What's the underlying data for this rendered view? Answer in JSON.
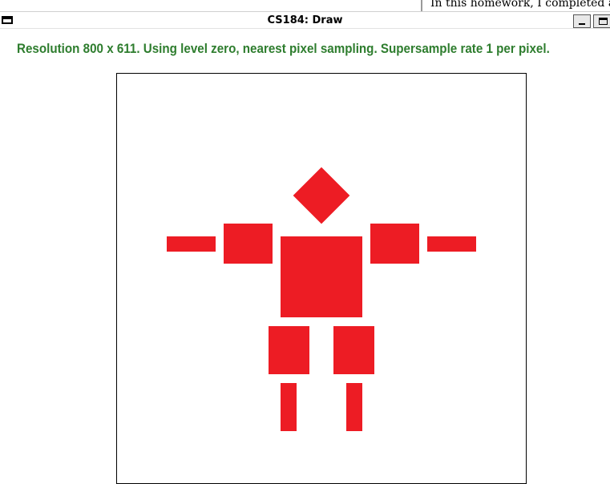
{
  "background_window": {
    "text": "In this homework, I completed an i"
  },
  "window": {
    "title": "CS184: Draw",
    "minimize_label": "_"
  },
  "status": {
    "text": "Resolution 800 x 611. Using level zero, nearest pixel sampling. Supersample rate 1 per pixel."
  },
  "colors": {
    "figure_fill": "#ED1C24",
    "status_text": "#2E7D2E"
  },
  "icons": [
    "window-menu-icon",
    "minimize-icon",
    "maximize-icon"
  ]
}
